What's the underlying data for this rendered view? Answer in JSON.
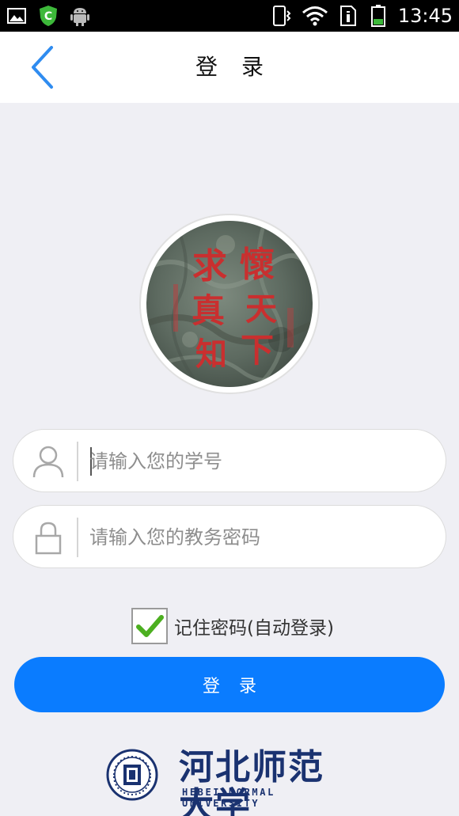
{
  "status_bar": {
    "time": "13:45",
    "icons": [
      "image-icon",
      "shield-icon",
      "android-icon",
      "vibrate-icon",
      "wifi-icon",
      "sim-icon",
      "battery-icon"
    ]
  },
  "header": {
    "title": "登录",
    "back_icon": "chevron-left-icon"
  },
  "avatar": {
    "image": "calligraphy-stone",
    "calligraphy_text": "怀天下求真知"
  },
  "form": {
    "username": {
      "value": "",
      "placeholder": "请输入您的学号",
      "icon": "user-icon"
    },
    "password": {
      "value": "",
      "placeholder": "请输入您的教务密码",
      "icon": "lock-icon"
    },
    "remember": {
      "label": "记住密码(自动登录)",
      "checked": true
    },
    "login_label": "登录"
  },
  "footer": {
    "university_cn": "河北师范大学",
    "university_en": "HEBEI NORMAL UNIVERSITY"
  },
  "colors": {
    "accent": "#0a7cff",
    "page_bg": "#efeff4",
    "check_green": "#4caf20",
    "brand_blue": "#1a3270"
  }
}
